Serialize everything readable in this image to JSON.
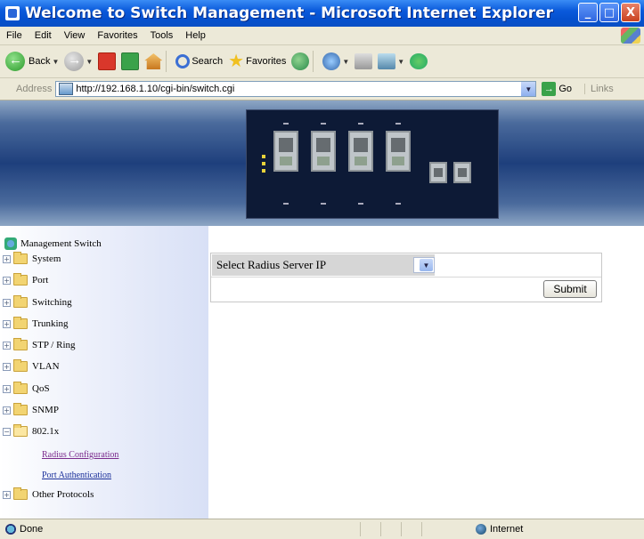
{
  "window": {
    "title": "Welcome to Switch Management - Microsoft Internet Explorer",
    "minimize": "_",
    "maximize": "□",
    "close": "X"
  },
  "menubar": {
    "items": [
      "File",
      "Edit",
      "View",
      "Favorites",
      "Tools",
      "Help"
    ]
  },
  "toolbar": {
    "back_label": "Back",
    "search_label": "Search",
    "favorites_label": "Favorites"
  },
  "addressbar": {
    "label": "Address",
    "url": "http://192.168.1.10/cgi-bin/switch.cgi",
    "go_label": "Go",
    "links_label": "Links"
  },
  "sidebar": {
    "root_label": "Management Switch",
    "folders": [
      {
        "label": "System",
        "expander": "+"
      },
      {
        "label": "Port",
        "expander": "+"
      },
      {
        "label": "Switching",
        "expander": "+"
      },
      {
        "label": "Trunking",
        "expander": "+"
      },
      {
        "label": "STP / Ring",
        "expander": "+"
      },
      {
        "label": "VLAN",
        "expander": "+"
      },
      {
        "label": "QoS",
        "expander": "+"
      },
      {
        "label": "SNMP",
        "expander": "+"
      },
      {
        "label": "802.1x",
        "expander": "−"
      },
      {
        "label": "Other Protocols",
        "expander": "+"
      }
    ],
    "links": [
      {
        "label": "Radius Configuration"
      },
      {
        "label": "Port Authentication"
      }
    ]
  },
  "form": {
    "label": "Select Radius Server IP",
    "selected_value": "",
    "submit_label": "Submit"
  },
  "statusbar": {
    "text": "Done",
    "zone": "Internet"
  },
  "colors": {
    "titlebar": "#0A5ADB",
    "chrome": "#ECE9D8",
    "visited_link": "#7a2a8c",
    "link": "#1a2f9a"
  }
}
